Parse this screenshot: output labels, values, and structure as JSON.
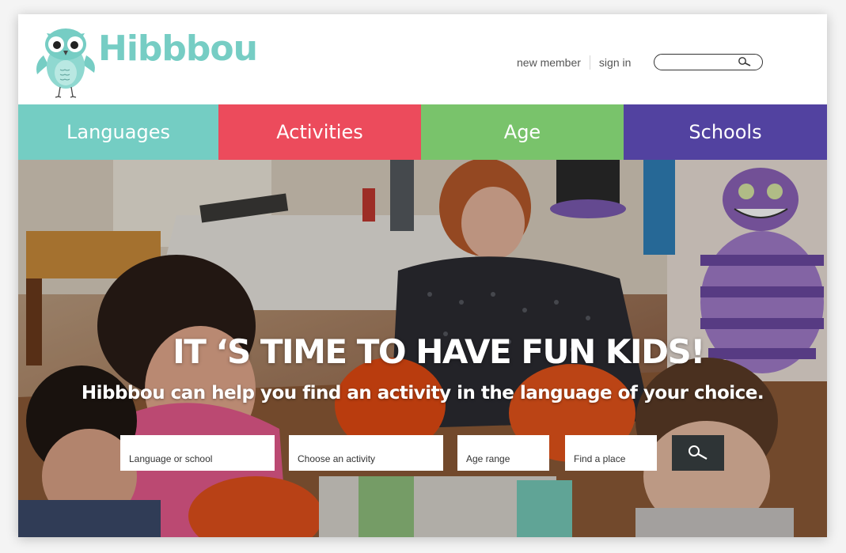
{
  "brand": {
    "name": "Hibbbou",
    "color": "#76cdc4",
    "logo_icon": "owl-icon"
  },
  "header": {
    "links": [
      "new member",
      "sign in"
    ],
    "search": {
      "placeholder": "",
      "icon": "search-icon"
    }
  },
  "categories": [
    {
      "label": "Languages",
      "color": "#74cdc3"
    },
    {
      "label": "Activities",
      "color": "#ec4b5c"
    },
    {
      "label": "Age",
      "color": "#79c36b"
    },
    {
      "label": "Schools",
      "color": "#5242a0"
    }
  ],
  "hero": {
    "title": "IT ‘S TIME TO HAVE FUN KIDS!",
    "subtitle": "Hibbbou can help you find an activity in the language of your choice.",
    "fields": [
      "Language or school",
      "Choose an activity",
      "Age range",
      "Find a place"
    ],
    "search_icon": "search-icon"
  }
}
